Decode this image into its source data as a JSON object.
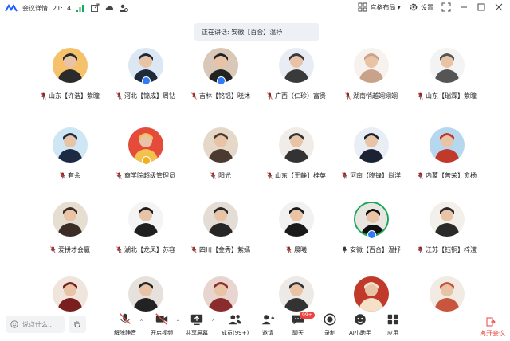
{
  "window": {
    "title": "会议详情",
    "time": "21:14",
    "layout_label": "宫格布局",
    "settings_label": "设置"
  },
  "speaker_banner": "正在讲话: 安徽【百合】温抒",
  "participants": [
    {
      "name": "山东【许浩】紫瞳",
      "mic": "muted",
      "host": false
    },
    {
      "name": "河北【锦成】周钻",
      "mic": "muted",
      "host": true
    },
    {
      "name": "吉林【铭铝】晓沐",
      "mic": "muted",
      "host": true
    },
    {
      "name": "广西（仁珍）富贵",
      "mic": "muted",
      "host": false
    },
    {
      "name": "湖南悄越翊翊翊",
      "mic": "muted",
      "host": false
    },
    {
      "name": "山东【瑞霖】紫瞳",
      "mic": "muted",
      "host": false
    },
    {
      "name": "有余",
      "mic": "muted",
      "host": false
    },
    {
      "name": "商学院超级管理员",
      "mic": "muted",
      "host": false,
      "crown": true
    },
    {
      "name": "阳光",
      "mic": "muted",
      "host": false
    },
    {
      "name": "山东【王静】桂英",
      "mic": "muted",
      "host": false
    },
    {
      "name": "河南【晓锋】尚洋",
      "mic": "muted",
      "host": false
    },
    {
      "name": "内蒙【普荣】愈杨",
      "mic": "muted",
      "host": false
    },
    {
      "name": "爱拼才会赢",
      "mic": "muted",
      "host": false
    },
    {
      "name": "湖北【龙凤】苏容",
      "mic": "muted",
      "host": false
    },
    {
      "name": "四川【金秀】紫嫣",
      "mic": "muted",
      "host": false
    },
    {
      "name": "晨曦",
      "mic": "muted",
      "host": false
    },
    {
      "name": "安徽【百合】温抒",
      "mic": "speaking",
      "host": true,
      "active": true
    },
    {
      "name": "江苏【钰铜】梓滢",
      "mic": "muted",
      "host": false
    },
    {
      "name": "",
      "mic": "none",
      "host": false
    },
    {
      "name": "",
      "mic": "none",
      "host": false
    },
    {
      "name": "",
      "mic": "none",
      "host": false
    },
    {
      "name": "",
      "mic": "none",
      "host": false
    },
    {
      "name": "",
      "mic": "none",
      "host": false
    },
    {
      "name": "",
      "mic": "none",
      "host": false
    }
  ],
  "toolbar": {
    "chat_placeholder": "说点什么...",
    "items": [
      {
        "label": "解除静音",
        "icon": "mic-muted-icon"
      },
      {
        "label": "开启视频",
        "icon": "video-off-icon"
      },
      {
        "label": "共享屏幕",
        "icon": "share-screen-icon"
      },
      {
        "label": "成员(99+)",
        "icon": "members-icon"
      },
      {
        "label": "邀请",
        "icon": "invite-icon"
      },
      {
        "label": "聊天",
        "icon": "chat-icon"
      },
      {
        "label": "录制",
        "icon": "record-icon"
      },
      {
        "label": "AI小助手",
        "icon": "ai-assistant-icon"
      },
      {
        "label": "应用",
        "icon": "apps-icon"
      }
    ],
    "chat_badge": "99+",
    "leave_label": "离开会议"
  },
  "colors": {
    "leave": "#e8453c",
    "active_ring": "#1ba75a",
    "mic_muted": "#e8453c",
    "host_badge": "#2f7cf6",
    "banner_bg": "#eef0f6"
  }
}
